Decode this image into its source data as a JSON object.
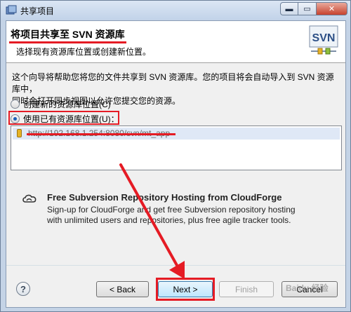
{
  "window": {
    "title": "共享项目",
    "controls": {
      "minimize": "▬",
      "maximize": "▭",
      "close": "✕"
    }
  },
  "banner": {
    "title": "将项目共享至 SVN 资源库",
    "description": "选择现有资源库位置或创建新位置。",
    "logo_text": "SVN"
  },
  "intro": {
    "line1": "这个向导将帮助您将您的文件共享到 SVN 资源库。您的项目将会自动导入到 SVN 资源库中，",
    "line2": "同时会打开同步视图以允许您提交您的资源。"
  },
  "options": {
    "create_new": {
      "label": "创建新的资源库位置(C)",
      "selected": false
    },
    "use_existing": {
      "label": "使用已有资源库位置(U)：",
      "selected": true
    }
  },
  "repositories": [
    {
      "url": "http://192.168.1.254:8080/svn/mt_app"
    }
  ],
  "cloudforge": {
    "title": "Free Subversion Repository Hosting from CloudForge",
    "line1": "Sign-up for CloudForge and get free Subversion repository hosting",
    "line2": "with unlimited users and repositories, plus free agile tracker tools."
  },
  "buttons": {
    "help": "?",
    "back": "< Back",
    "next": "Next >",
    "finish": "Finish",
    "cancel": "Cancel"
  },
  "watermark": "Baidu 经验",
  "colors": {
    "annotation_red": "#e51b24",
    "selection_blue": "#dfe8f6",
    "title_bar": "#c4d3e6"
  }
}
